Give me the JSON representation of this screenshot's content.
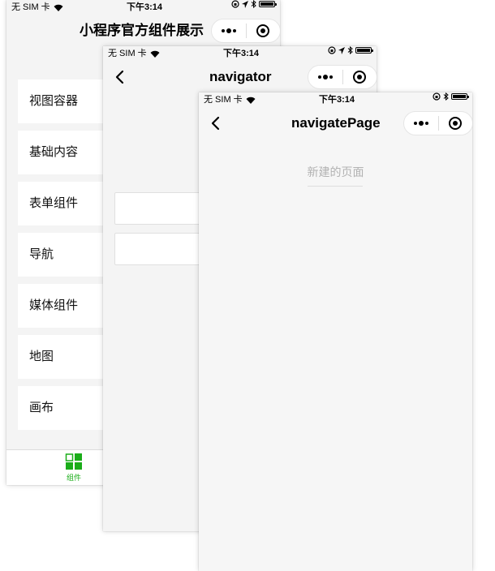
{
  "status": {
    "carrier": "无 SIM 卡",
    "time": "下午3:14"
  },
  "phone1": {
    "title": "小程序官方组件展示",
    "items": [
      {
        "label": "视图容器"
      },
      {
        "label": "基础内容"
      },
      {
        "label": "表单组件"
      },
      {
        "label": "导航"
      },
      {
        "label": "媒体组件"
      },
      {
        "label": "地图"
      },
      {
        "label": "画布"
      }
    ],
    "tab": {
      "label": "组件",
      "color": "#1aad19"
    }
  },
  "phone2": {
    "title": "navigator"
  },
  "phone3": {
    "title": "navigatePage",
    "page_text": "新建的页面"
  }
}
